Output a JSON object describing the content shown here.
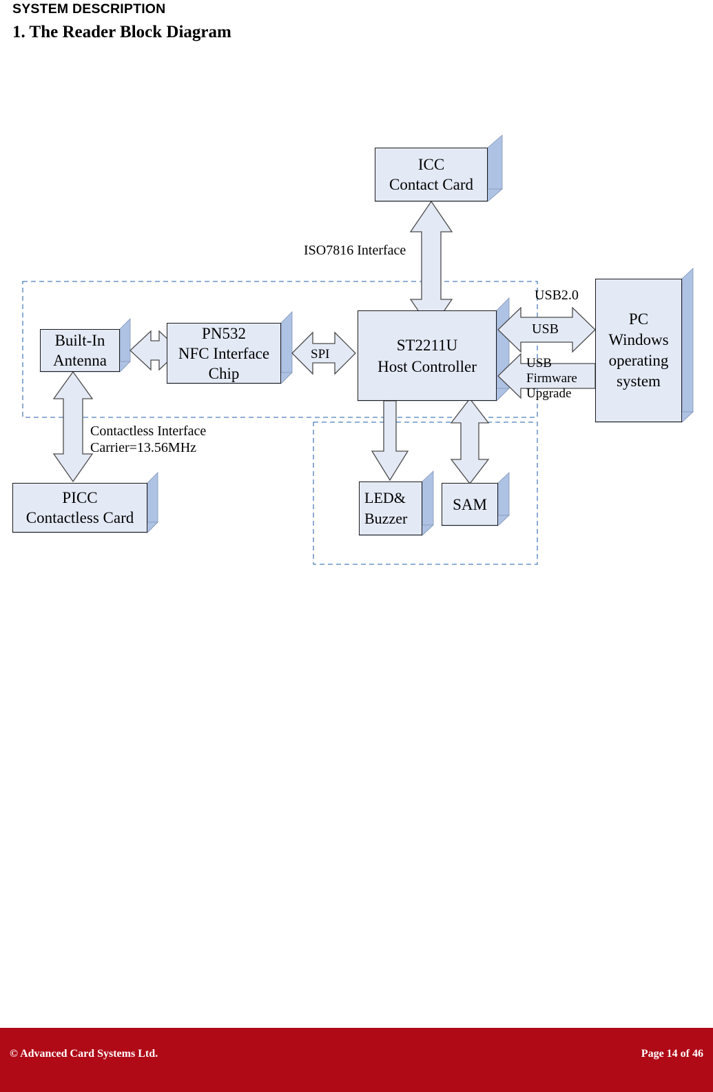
{
  "header": {
    "eyebrow": "SYSTEM DESCRIPTION",
    "title": "1. The Reader Block Diagram"
  },
  "diagram": {
    "blocks": [
      {
        "id": "icc",
        "label": "ICC\nContact Card"
      },
      {
        "id": "antenna",
        "label": "Built-In\nAntenna"
      },
      {
        "id": "pn532",
        "label": "PN532\nNFC Interface\nChip"
      },
      {
        "id": "host",
        "label": "ST2211U\nHost Controller"
      },
      {
        "id": "pc",
        "label": "PC\nWindows\noperating\nsystem"
      },
      {
        "id": "picc",
        "label": "PICC\nContactless Card"
      },
      {
        "id": "led",
        "label": "LED&\nBuzzer"
      },
      {
        "id": "sam",
        "label": "SAM"
      }
    ],
    "labels": {
      "iso7816": "ISO7816 Interface",
      "spi": "SPI",
      "usb20": "USB2.0",
      "usb": "USB",
      "usb_firmware_upgrade": "USB\nFirmware\nUpgrade",
      "contactless": "Contactless Interface\n Carrier=13.56MHz"
    },
    "colors": {
      "block_fill": "#e4eaf5",
      "block_border": "#1a1a1a",
      "block_shadow": "#aec2e4",
      "arrow_fill": "#e4eaf5",
      "arrow_border": "#4a4a4a",
      "boundary_dashed": "#4a7ebb"
    }
  },
  "footer": {
    "copyright": "© Advanced Card Systems Ltd.",
    "page": "Page 14 of 46"
  }
}
